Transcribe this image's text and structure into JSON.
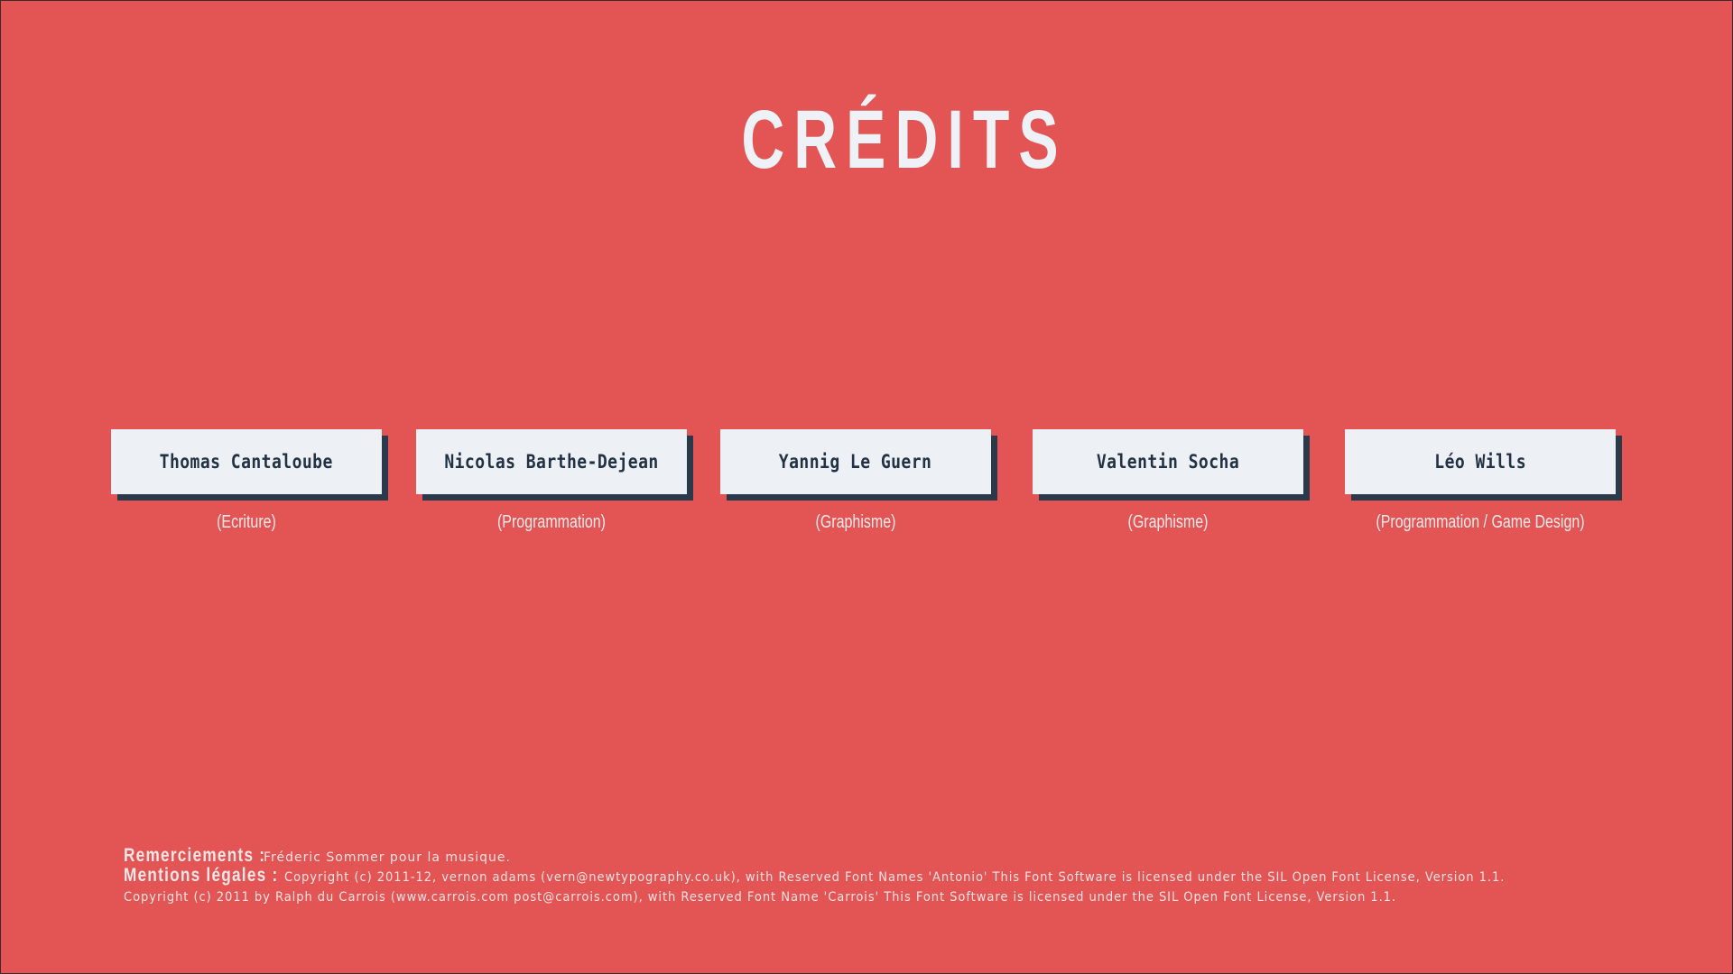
{
  "page": {
    "title": "CRÉDITS"
  },
  "credits": [
    {
      "name": "Thomas Cantaloube",
      "role": "(Ecriture)"
    },
    {
      "name": "Nicolas Barthe-Dejean",
      "role": "(Programmation)"
    },
    {
      "name": "Yannig Le Guern",
      "role": "(Graphisme)"
    },
    {
      "name": "Valentin Socha",
      "role": "(Graphisme)"
    },
    {
      "name": "Léo Wills",
      "role": "(Programmation / Game Design)"
    }
  ],
  "footer": {
    "thanks_label": "Remerciements :",
    "thanks_text": "Fréderic Sommer pour la musique.",
    "legal_label": "Mentions légales :",
    "legal_text_1": "Copyright (c) 2011-12, vernon adams (vern@newtypography.co.uk), with Reserved Font Names 'Antonio' This Font Software is licensed under the SIL Open Font License, Version 1.1.",
    "legal_text_2": "Copyright (c) 2011 by Ralph du Carrois (www.carrois.com post@carrois.com), with Reserved Font Name 'Carrois' This Font Software is licensed under the SIL Open Font License, Version 1.1."
  },
  "colors": {
    "background": "#e25554",
    "card": "#edf1f5",
    "card_shadow": "#2b3a4a",
    "card_text": "#223244",
    "light_text": "#eef1f5"
  }
}
